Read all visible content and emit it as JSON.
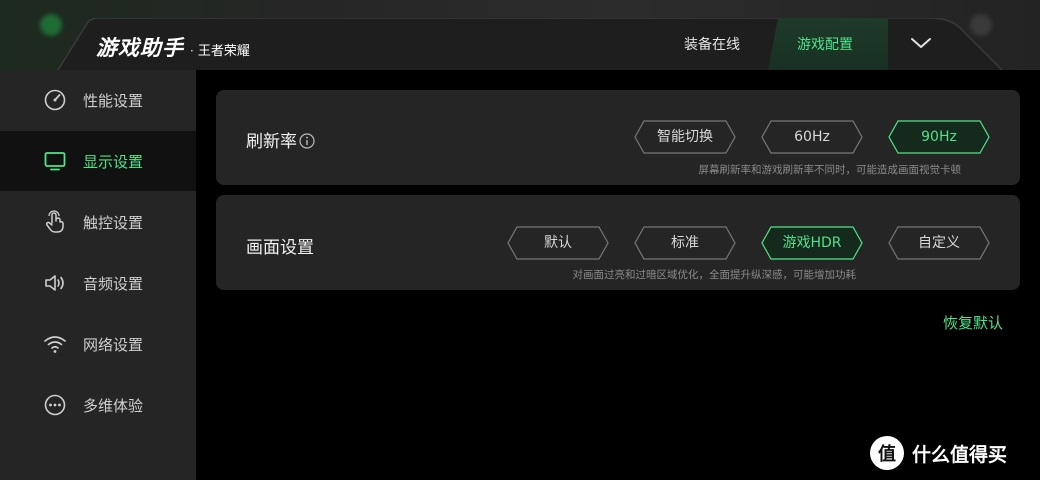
{
  "header": {
    "title": "游戏助手",
    "separator": "·",
    "game": "王者荣耀",
    "tabs": [
      {
        "label": "装备在线",
        "active": false
      },
      {
        "label": "游戏配置",
        "active": true
      }
    ]
  },
  "sidebar": {
    "items": [
      {
        "label": "性能设置",
        "icon": "speedometer-icon",
        "active": false
      },
      {
        "label": "显示设置",
        "icon": "monitor-icon",
        "active": true
      },
      {
        "label": "触控设置",
        "icon": "touch-hand-icon",
        "active": false
      },
      {
        "label": "音频设置",
        "icon": "speaker-icon",
        "active": false
      },
      {
        "label": "网络设置",
        "icon": "wifi-icon",
        "active": false
      },
      {
        "label": "多维体验",
        "icon": "more-dots-icon",
        "active": false
      }
    ]
  },
  "refresh": {
    "title": "刷新率",
    "options": [
      {
        "label": "智能切换",
        "selected": false
      },
      {
        "label": "60Hz",
        "selected": false
      },
      {
        "label": "90Hz",
        "selected": true
      }
    ],
    "hint": "屏幕刷新率和游戏刷新率不同时，可能造成画面视觉卡顿"
  },
  "picture": {
    "title": "画面设置",
    "options": [
      {
        "label": "默认",
        "selected": false
      },
      {
        "label": "标准",
        "selected": false
      },
      {
        "label": "游戏HDR",
        "selected": true
      },
      {
        "label": "自定义",
        "selected": false
      }
    ],
    "hint": "对画面过亮和过暗区域优化，全面提升纵深感，可能增加功耗"
  },
  "restore_label": "恢复默认",
  "watermark": {
    "logo": "值",
    "text": "什么值得买"
  },
  "colors": {
    "accent": "#4fe38a",
    "panel": "#252525",
    "sidebar": "#252525",
    "background": "#000000"
  }
}
